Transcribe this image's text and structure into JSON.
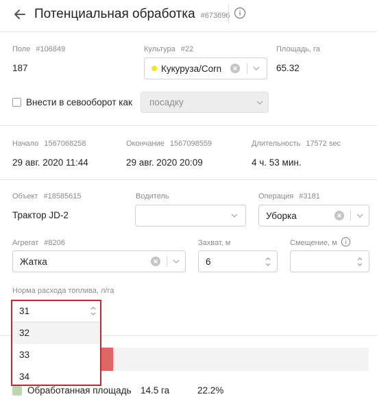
{
  "header": {
    "title": "Потенциальная обработка",
    "id": "#673696"
  },
  "field": {
    "label": "Поле",
    "id": "#106849",
    "value": "187"
  },
  "crop": {
    "label": "Культура",
    "id": "#22",
    "value": "Кукуруза/Corn",
    "dot_color": "#f2e51b"
  },
  "area": {
    "label": "Площадь, га",
    "value": "65.32"
  },
  "rotation": {
    "checkbox_label": "Внести в севооборот как",
    "select_value": "посадку"
  },
  "start": {
    "label": "Начало",
    "id": "1567068258",
    "value": "29 авг. 2020 11:44"
  },
  "end": {
    "label": "Окончание",
    "id": "1567098559",
    "value": "29 авг. 2020 20:09"
  },
  "duration": {
    "label": "Длительность",
    "id": "17572 sec",
    "value": "4 ч. 53 мин."
  },
  "object": {
    "label": "Объект",
    "id": "#18585615",
    "value": "Трактор JD-2"
  },
  "driver": {
    "label": "Водитель",
    "value": ""
  },
  "operation": {
    "label": "Операция",
    "id": "#3181",
    "value": "Уборка"
  },
  "implement": {
    "label": "Агрегат",
    "id": "#8206",
    "value": "Жатка"
  },
  "width": {
    "label": "Захват, м",
    "value": "6"
  },
  "offset": {
    "label": "Смещение, м",
    "value": ""
  },
  "fuel": {
    "label": "Норма расхода топлива, л/га",
    "value": "31",
    "options": [
      "32",
      "33",
      "34"
    ]
  },
  "legend": {
    "label": "Обработанная площадь",
    "area": "14.5 га",
    "percent": "22.2%",
    "color": "#b8d8b0",
    "bar_color": "#e06666",
    "bar_fraction": 0.222
  }
}
